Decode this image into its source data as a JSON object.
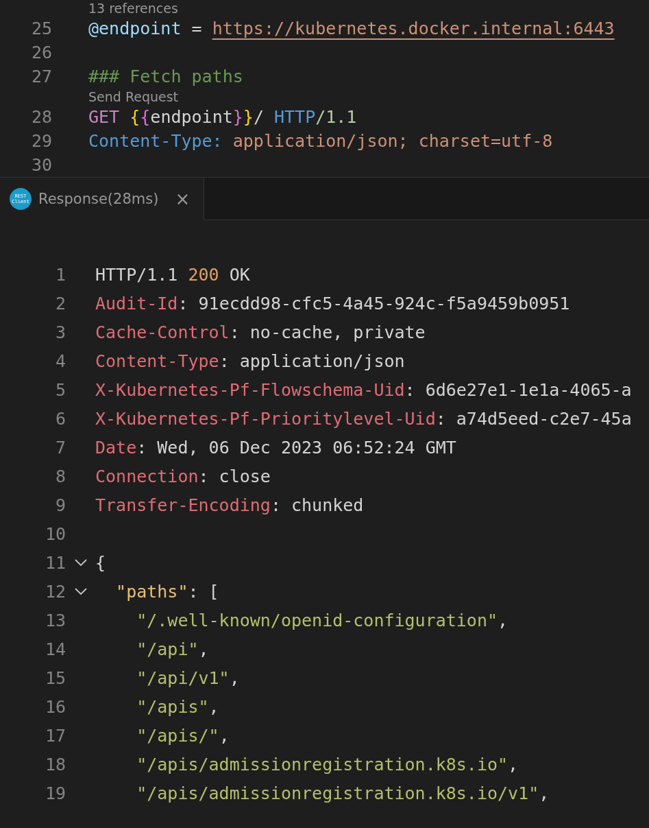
{
  "request_editor": {
    "lines": [
      {
        "kind": "codelens",
        "text": "13 references"
      },
      {
        "kind": "code",
        "number": "25",
        "tokens": [
          {
            "text": "@endpoint",
            "kind": "variable"
          },
          {
            "text": " = ",
            "kind": "plain"
          },
          {
            "text": "https://kubernetes.docker.internal:6443",
            "kind": "url"
          }
        ]
      },
      {
        "kind": "code",
        "number": "26"
      },
      {
        "kind": "code",
        "number": "27",
        "tokens": [
          {
            "text": "### Fetch paths",
            "kind": "comment"
          }
        ]
      },
      {
        "kind": "codelens",
        "text": "Send Request"
      },
      {
        "kind": "code",
        "number": "28",
        "tokens": [
          {
            "text": "GET ",
            "kind": "method"
          },
          {
            "text": "{",
            "kind": "brace"
          },
          {
            "text": "{",
            "kind": "brace2"
          },
          {
            "text": "endpoint",
            "kind": "plain"
          },
          {
            "text": "}",
            "kind": "brace2"
          },
          {
            "text": "}",
            "kind": "brace"
          },
          {
            "text": "/ ",
            "kind": "plain"
          },
          {
            "text": "HTTP",
            "kind": "keyword"
          },
          {
            "text": "/1.1",
            "kind": "version"
          }
        ]
      },
      {
        "kind": "code",
        "number": "29",
        "tokens": [
          {
            "text": "Content-Type:",
            "kind": "keyword"
          },
          {
            "text": " application/json; charset=utf-8",
            "kind": "value"
          }
        ]
      },
      {
        "kind": "code",
        "number": "30"
      }
    ]
  },
  "tab": {
    "label": "Response(28ms)",
    "icon_lines": [
      "REST",
      "Client"
    ],
    "close": "×",
    "selected": true
  },
  "response_editor": {
    "lines": [
      {
        "number": "1",
        "tokens": [
          {
            "text": "HTTP/1.1 ",
            "kind": "plain"
          },
          {
            "text": "200",
            "kind": "status"
          },
          {
            "text": " OK",
            "kind": "plain"
          }
        ]
      },
      {
        "number": "2",
        "tokens": [
          {
            "text": "Audit-Id",
            "kind": "header"
          },
          {
            "text": ": 91ecdd98-cfc5-4a45-924c-f5a9459b0951",
            "kind": "plain"
          }
        ]
      },
      {
        "number": "3",
        "tokens": [
          {
            "text": "Cache-Control",
            "kind": "header"
          },
          {
            "text": ": no-cache, private",
            "kind": "plain"
          }
        ]
      },
      {
        "number": "4",
        "tokens": [
          {
            "text": "Content-Type",
            "kind": "header"
          },
          {
            "text": ": application/json",
            "kind": "plain"
          }
        ]
      },
      {
        "number": "5",
        "tokens": [
          {
            "text": "X-Kubernetes-Pf-Flowschema-Uid",
            "kind": "header"
          },
          {
            "text": ": 6d6e27e1-1e1a-4065-a",
            "kind": "plain"
          }
        ]
      },
      {
        "number": "6",
        "tokens": [
          {
            "text": "X-Kubernetes-Pf-Prioritylevel-Uid",
            "kind": "header"
          },
          {
            "text": ": a74d5eed-c2e7-45a",
            "kind": "plain"
          }
        ]
      },
      {
        "number": "7",
        "tokens": [
          {
            "text": "Date",
            "kind": "header"
          },
          {
            "text": ": Wed, 06 Dec 2023 06:52:24 GMT",
            "kind": "plain"
          }
        ]
      },
      {
        "number": "8",
        "tokens": [
          {
            "text": "Connection",
            "kind": "header"
          },
          {
            "text": ": close",
            "kind": "plain"
          }
        ]
      },
      {
        "number": "9",
        "tokens": [
          {
            "text": "Transfer-Encoding",
            "kind": "header"
          },
          {
            "text": ": chunked",
            "kind": "plain"
          }
        ]
      },
      {
        "number": "10"
      },
      {
        "number": "11",
        "expanded": true,
        "tokens": [
          {
            "text": "{",
            "kind": "plain"
          }
        ]
      },
      {
        "number": "12",
        "expanded": true,
        "tokens": [
          {
            "text": "  \"paths\"",
            "kind": "key"
          },
          {
            "text": ": [",
            "kind": "plain"
          }
        ]
      },
      {
        "number": "13",
        "tokens": [
          {
            "text": "    \"/.well-known/openid-configuration\"",
            "kind": "string"
          },
          {
            "text": ",",
            "kind": "plain"
          }
        ]
      },
      {
        "number": "14",
        "tokens": [
          {
            "text": "    \"/api\"",
            "kind": "string"
          },
          {
            "text": ",",
            "kind": "plain"
          }
        ]
      },
      {
        "number": "15",
        "tokens": [
          {
            "text": "    \"/api/v1\"",
            "kind": "string"
          },
          {
            "text": ",",
            "kind": "plain"
          }
        ]
      },
      {
        "number": "16",
        "tokens": [
          {
            "text": "    \"/apis\"",
            "kind": "string"
          },
          {
            "text": ",",
            "kind": "plain"
          }
        ]
      },
      {
        "number": "17",
        "tokens": [
          {
            "text": "    \"/apis/\"",
            "kind": "string"
          },
          {
            "text": ",",
            "kind": "plain"
          }
        ]
      },
      {
        "number": "18",
        "tokens": [
          {
            "text": "    \"/apis/admissionregistration.k8s.io\"",
            "kind": "string"
          },
          {
            "text": ",",
            "kind": "plain"
          }
        ]
      },
      {
        "number": "19",
        "tokens": [
          {
            "text": "    \"/apis/admissionregistration.k8s.io/v1\"",
            "kind": "string"
          },
          {
            "text": ",",
            "kind": "plain"
          }
        ]
      }
    ]
  }
}
